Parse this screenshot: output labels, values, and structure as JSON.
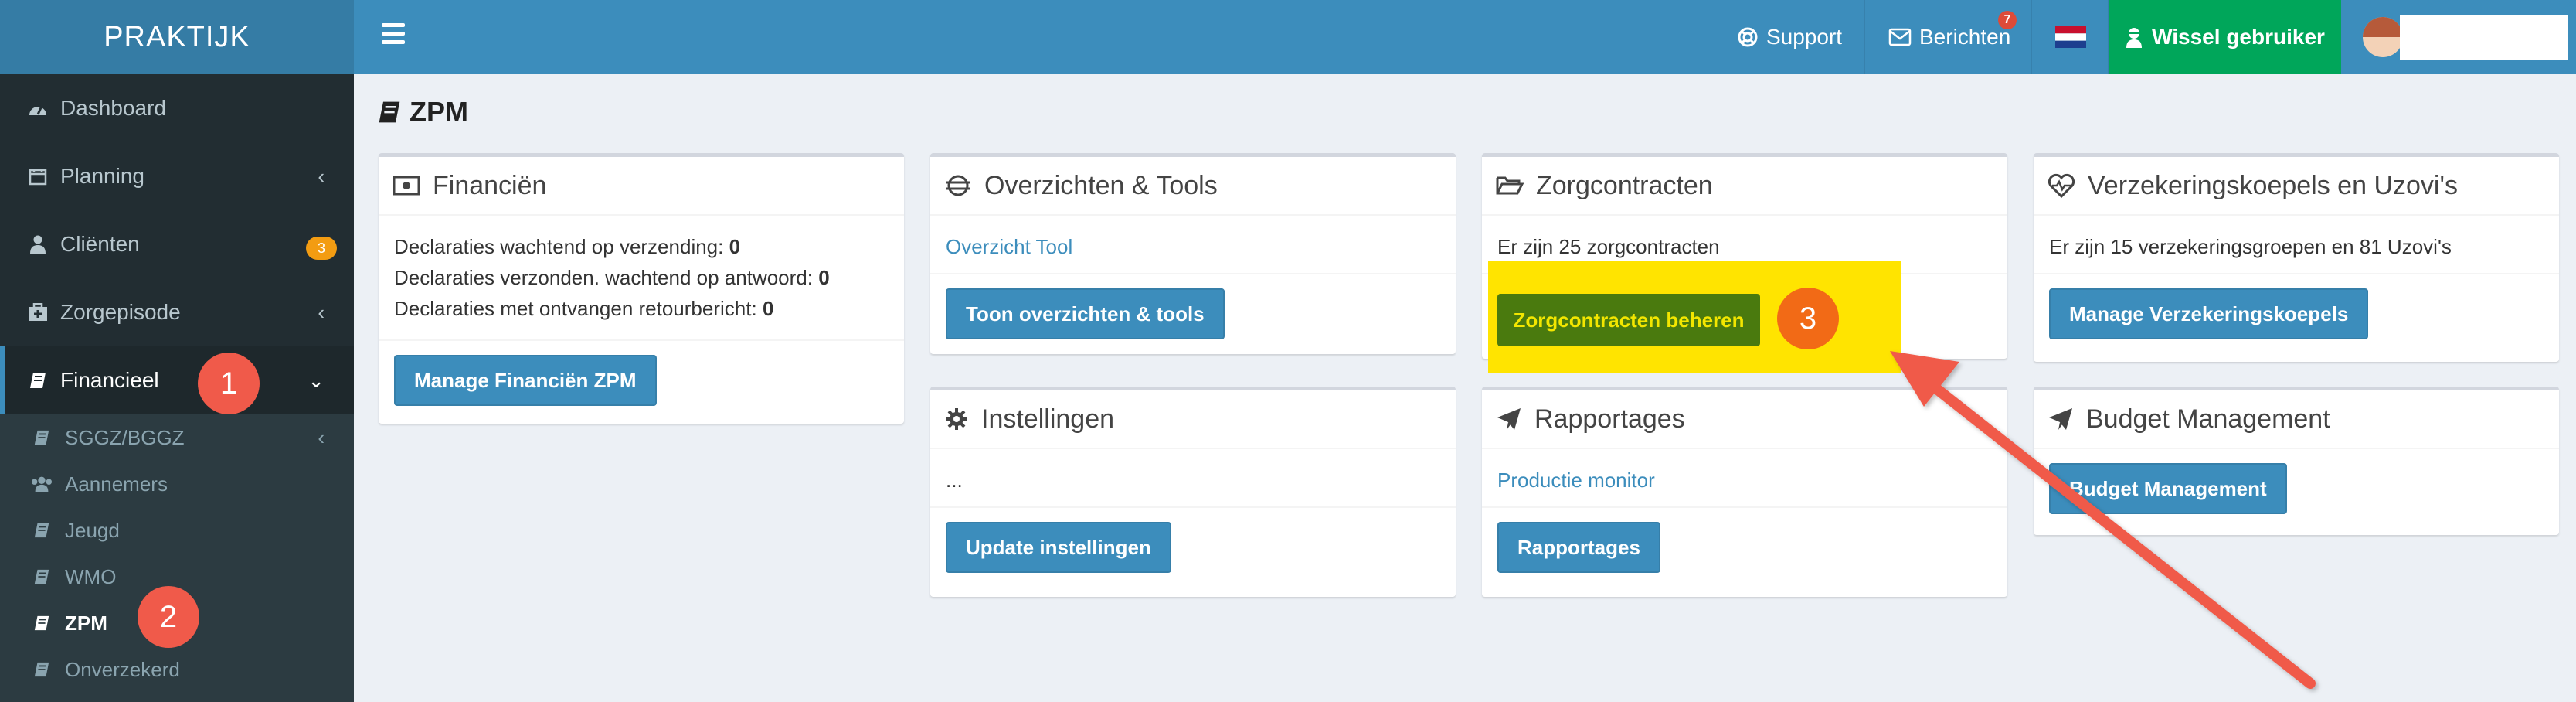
{
  "app": {
    "logo": "PRAKTIJK"
  },
  "topbar": {
    "support": "Support",
    "berichten": "Berichten",
    "berichten_badge": "7",
    "wissel": "Wissel gebruiker"
  },
  "sidebar": {
    "dashboard": "Dashboard",
    "planning": "Planning",
    "clienten": "Cliënten",
    "clienten_badge": "3",
    "zorgepisode": "Zorgepisode",
    "financieel": "Financieel",
    "sub": {
      "sggz": "SGGZ/BGGZ",
      "aannemers": "Aannemers",
      "jeugd": "Jeugd",
      "wmo": "WMO",
      "zpm": "ZPM",
      "onverzekerd": "Onverzekerd"
    }
  },
  "steps": {
    "one": "1",
    "two": "2",
    "three": "3"
  },
  "page": {
    "title": "ZPM"
  },
  "boxes": {
    "financien": {
      "title": "Financiën",
      "line1_label": "Declaraties wachtend op verzending:",
      "line1_value": "0",
      "line2_label": "Declaraties verzonden. wachtend op antwoord:",
      "line2_value": "0",
      "line3_label": "Declaraties met ontvangen retourbericht:",
      "line3_value": "0",
      "button": "Manage Financiën ZPM"
    },
    "overzichten": {
      "title": "Overzichten & Tools",
      "link": "Overzicht Tool",
      "button": "Toon overzichten & tools"
    },
    "zorgcontracten": {
      "title": "Zorgcontracten",
      "text": "Er zijn 25 zorgcontracten",
      "button": "Zorgcontracten beheren"
    },
    "verzekeringskoepels": {
      "title": "Verzekeringskoepels en Uzovi's",
      "text": "Er zijn 15 verzekeringsgroepen en 81 Uzovi's",
      "button": "Manage Verzekeringskoepels"
    },
    "instellingen": {
      "title": "Instellingen",
      "text": "...",
      "button": "Update instellingen"
    },
    "rapportages": {
      "title": "Rapportages",
      "link": "Productie monitor",
      "button": "Rapportages"
    },
    "budget": {
      "title": "Budget Management",
      "button": "Budget Management"
    }
  },
  "colors": {
    "topbar": "#3c8dbc",
    "logo_bg": "#357ca5",
    "sidebar": "#222d32",
    "wissel": "#00a65a",
    "highlight": "#ffe400",
    "annotation": "#f05a4a"
  }
}
